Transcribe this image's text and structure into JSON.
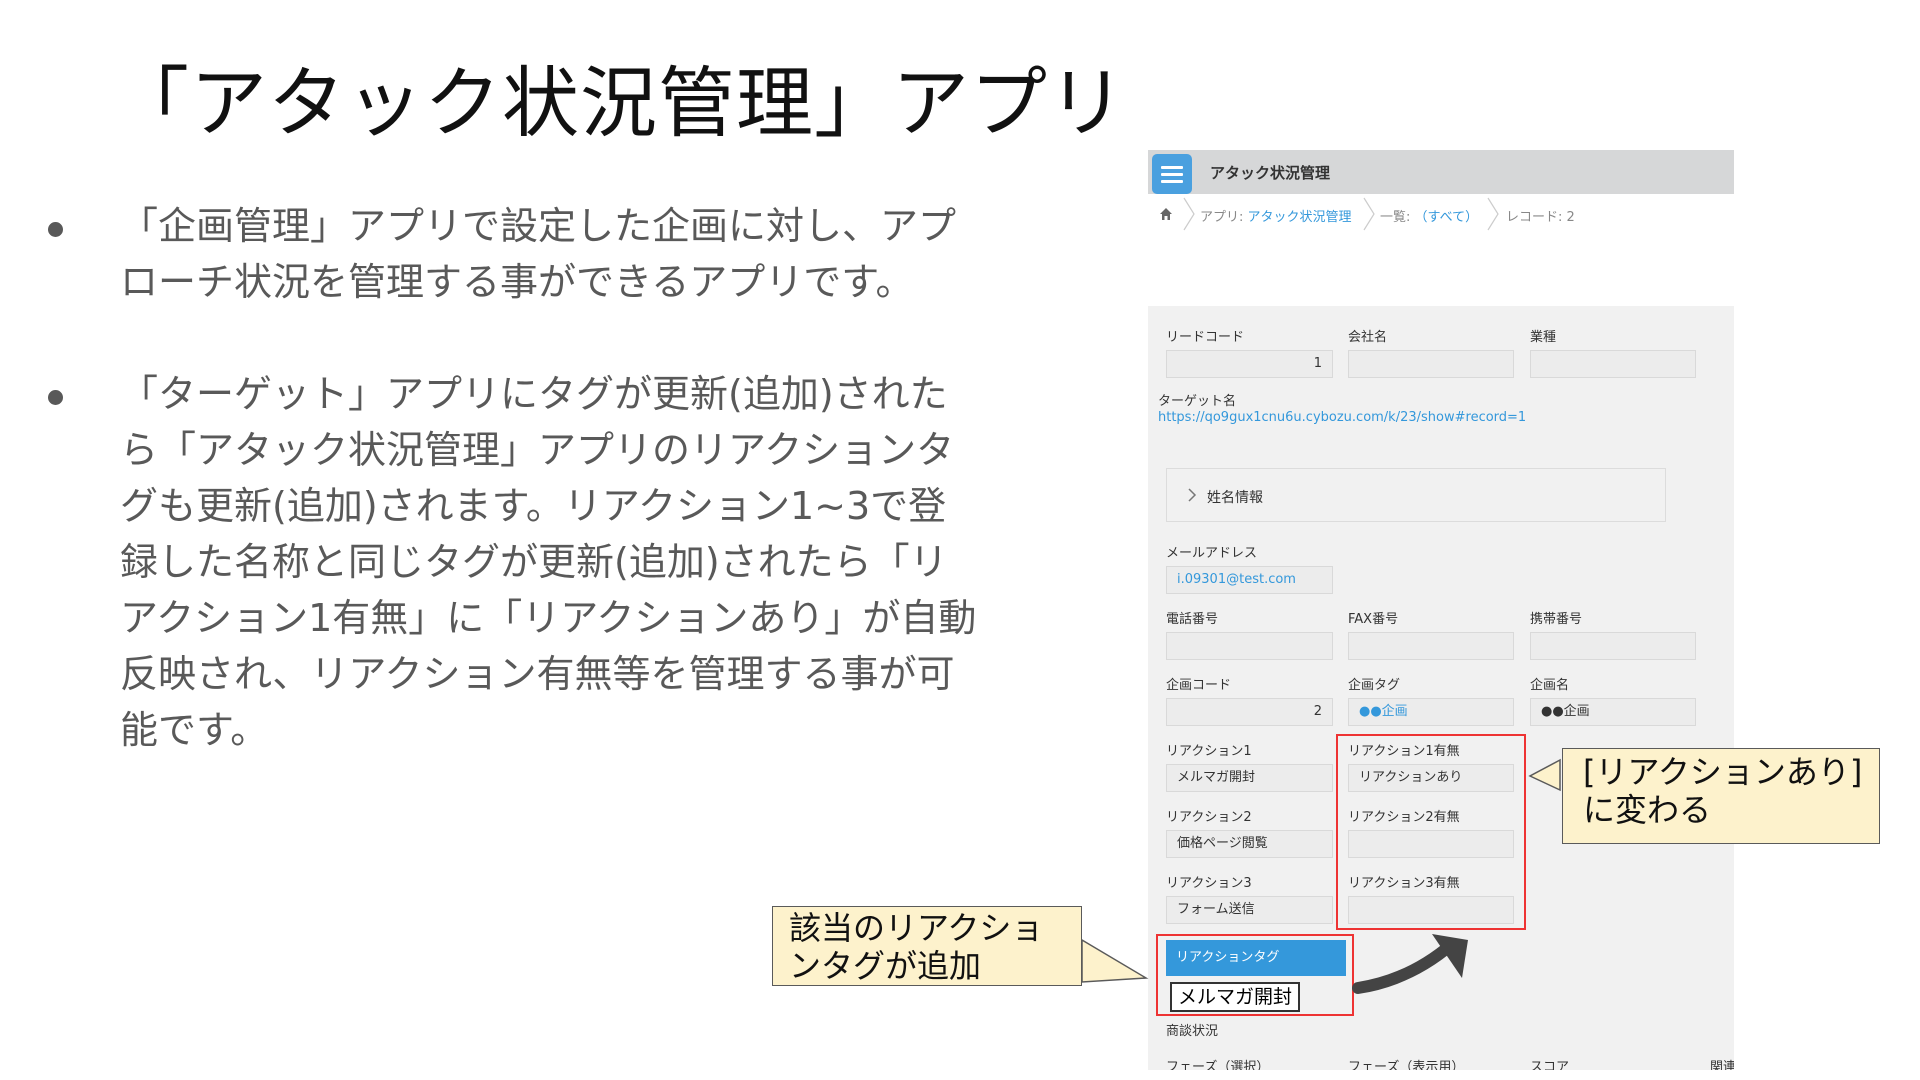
{
  "slide": {
    "title": "「アタック状況管理」アプリ",
    "bullets": [
      "「企画管理」アプリで設定した企画に対し、アプローチ状況を管理する事ができるアプリです。",
      "「ターゲット」アプリにタグが更新(追加)されたら「アタック状況管理」アプリのリアクションタグも更新(追加)されます。リアクション1~3で登録した名称と同じタグが更新(追加)されたら「リアクション1有無」に「リアクションあり」が自動反映され、リアクション有無等を管理する事が可能です。"
    ]
  },
  "app": {
    "name": "アタック状況管理",
    "breadcrumb": {
      "app_prefix": "アプリ: ",
      "app_link": "アタック状況管理",
      "list_prefix": "一覧: ",
      "list_link": "（すべて）",
      "record": "レコード: 2"
    },
    "fields": {
      "lead_code": {
        "label": "リードコード",
        "value": "1"
      },
      "company": {
        "label": "会社名",
        "value": ""
      },
      "industry": {
        "label": "業種",
        "value": ""
      },
      "target_name": {
        "label": "ターゲット名",
        "value": "https://qo9gux1cnu6u.cybozu.com/k/23/show#record=1"
      },
      "name_group": {
        "label": "姓名情報"
      },
      "email": {
        "label": "メールアドレス",
        "value": "i.09301@test.com"
      },
      "phone": {
        "label": "電話番号",
        "value": ""
      },
      "fax": {
        "label": "FAX番号",
        "value": ""
      },
      "mobile": {
        "label": "携帯番号",
        "value": ""
      },
      "plan_code": {
        "label": "企画コード",
        "value": "2"
      },
      "plan_tag": {
        "label": "企画タグ",
        "value": "●●企画"
      },
      "plan_name": {
        "label": "企画名",
        "value": "●●企画"
      },
      "reaction1": {
        "label": "リアクション1",
        "value": "メルマガ開封"
      },
      "reaction1_flag": {
        "label": "リアクション1有無",
        "value": "リアクションあり"
      },
      "reaction2": {
        "label": "リアクション2",
        "value": "価格ページ閲覧"
      },
      "reaction2_flag": {
        "label": "リアクション2有無",
        "value": ""
      },
      "reaction3": {
        "label": "リアクション3",
        "value": "フォーム送信"
      },
      "reaction3_flag": {
        "label": "リアクション3有無",
        "value": ""
      },
      "reaction_tag": {
        "label": "リアクションタグ",
        "value": "メルマガ開封"
      },
      "deal_status": {
        "label": "商談状況"
      },
      "phase_select": {
        "label": "フェーズ（選択）"
      },
      "phase_display": {
        "label": "フェーズ（表示用）"
      },
      "score": {
        "label": "スコア"
      },
      "related": {
        "label": "関連"
      }
    }
  },
  "callouts": {
    "reaction_changed": "[リアクションあり]\nに変わる",
    "tag_added": "該当のリアクショ\nンタグが追加"
  },
  "colors": {
    "accent_blue": "#3498db",
    "highlight_red": "#e33333",
    "callout_fill": "#fdf2cc"
  }
}
